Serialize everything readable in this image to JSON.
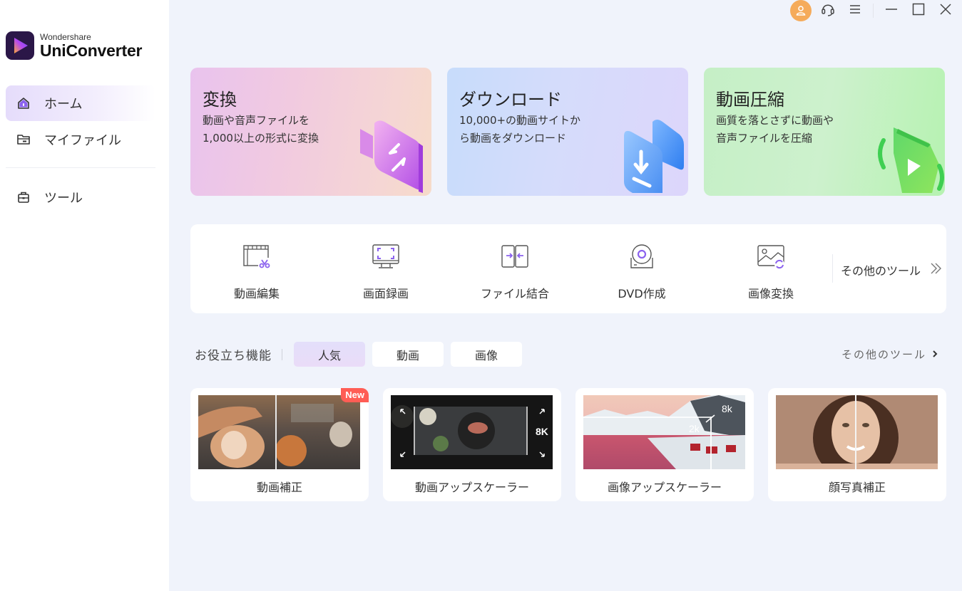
{
  "app": {
    "brand": "Wondershare",
    "product": "UniConverter"
  },
  "colors": {
    "accent": "#8b62ee",
    "avatar": "#f5ab5b",
    "new_badge": "#ff5d55",
    "background": "#f0f3fb"
  },
  "sidebar": {
    "items": [
      {
        "label": "ホーム",
        "icon": "home-icon",
        "active": true
      },
      {
        "label": "マイファイル",
        "icon": "folder-icon",
        "active": false
      },
      {
        "label": "ツール",
        "icon": "toolbox-icon",
        "active": false
      }
    ]
  },
  "titlebar": {
    "icons": [
      "user-avatar-icon",
      "headset-icon",
      "menu-icon",
      "minimize-icon",
      "maximize-icon",
      "close-icon"
    ]
  },
  "features": [
    {
      "title": "変換",
      "desc": "動画や音声ファイルを1,000以上の形式に変換",
      "icon": "convert-camera-icon"
    },
    {
      "title": "ダウンロード",
      "desc": "10,000+の動画サイトから動画をダウンロード",
      "icon": "download-icon"
    },
    {
      "title": "動画圧縮",
      "desc": "画質を落とさずに動画や音声ファイルを圧縮",
      "icon": "compress-icon"
    }
  ],
  "tools": {
    "items": [
      {
        "label": "動画編集",
        "icon": "video-edit-icon"
      },
      {
        "label": "画面録画",
        "icon": "screen-record-icon"
      },
      {
        "label": "ファイル結合",
        "icon": "merge-icon"
      },
      {
        "label": "DVD作成",
        "icon": "dvd-icon"
      },
      {
        "label": "画像変換",
        "icon": "image-convert-icon"
      }
    ],
    "more_label": "その他のツール"
  },
  "useful": {
    "title": "お役立ち機能",
    "tabs": [
      {
        "label": "人気",
        "active": true
      },
      {
        "label": "動画",
        "active": false
      },
      {
        "label": "画像",
        "active": false
      }
    ],
    "more_label": "その他のツール",
    "cards": [
      {
        "label": "動画補正",
        "badge": "New"
      },
      {
        "label": "動画アップスケーラー",
        "overlay": "8K"
      },
      {
        "label": "画像アップスケーラー",
        "overlay_from": "2k",
        "overlay_to": "8k"
      },
      {
        "label": "顔写真補正"
      }
    ]
  }
}
